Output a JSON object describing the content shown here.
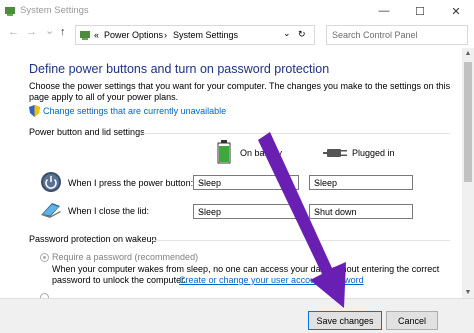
{
  "window": {
    "title": "System Settings",
    "minimize": "—",
    "maximize": "☐",
    "close": "✕"
  },
  "address": {
    "back": "←",
    "forward": "→",
    "dropdown": "⌄",
    "up": "↑",
    "prefix": "«",
    "crumb1": "Power Options",
    "separator": "›",
    "crumb2": "System Settings",
    "crumb_dropdown": "⌄",
    "refresh": "↻",
    "search_placeholder": "Search Control Panel"
  },
  "main": {
    "heading": "Define power buttons and turn on password protection",
    "description": "Choose the power settings that you want for your computer. The changes you make to the settings on this page apply to all of your power plans.",
    "change_link": "Change settings that are currently unavailable",
    "section1": "Power button and lid settings",
    "col_battery": "On battery",
    "col_plugged": "Plugged in",
    "rows": [
      {
        "label": "When I press the power button:",
        "battery": "Sleep",
        "plugged": "Sleep"
      },
      {
        "label": "When I close the lid:",
        "battery": "Sleep",
        "plugged": "Shut down"
      }
    ],
    "section2": "Password protection on wakeup",
    "require_password_label": "Require a password (recommended)",
    "require_password_desc_1": "When your computer wakes from sleep, no one can access your data without entering the correct",
    "require_password_desc_2": "password to unlock the computer.",
    "create_password_link": "Create or change your user account password"
  },
  "footer": {
    "save": "Save changes",
    "cancel": "Cancel"
  },
  "colors": {
    "heading": "#1e3287",
    "link": "#0066cc",
    "arrow": "#6a1fb3"
  }
}
